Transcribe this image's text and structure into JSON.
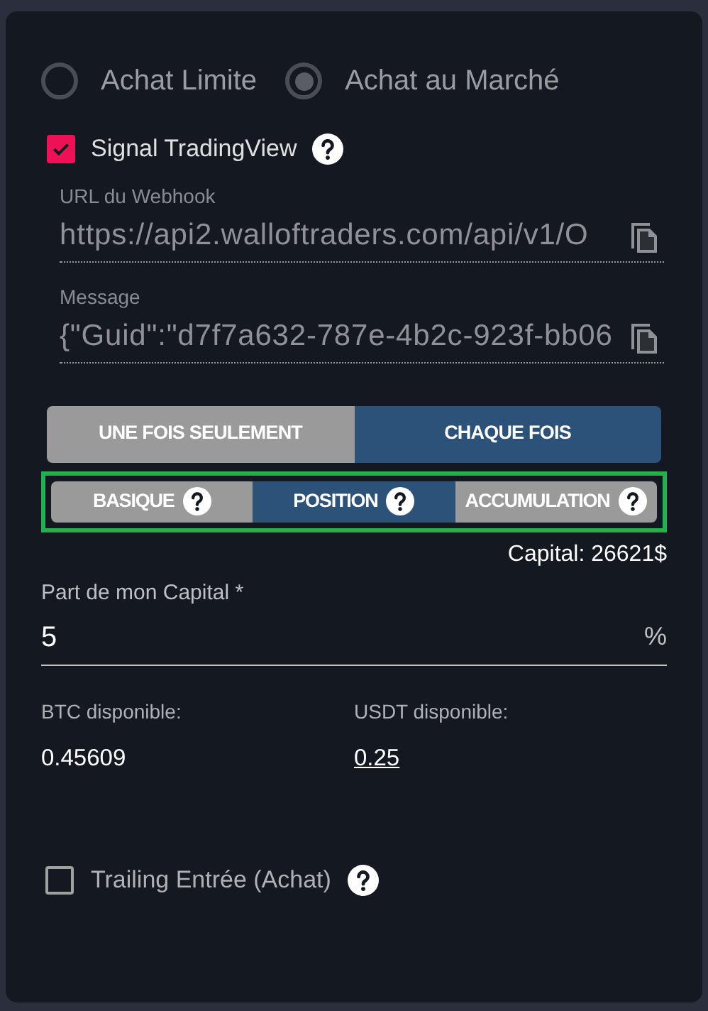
{
  "order_types": [
    {
      "label": "Achat Limite",
      "selected": false
    },
    {
      "label": "Achat au Marché",
      "selected": true
    }
  ],
  "tradingview": {
    "label": "Signal TradingView",
    "checked": true,
    "fields": [
      {
        "label": "URL du Webhook",
        "value": "https://api2.walloftraders.com/api/v1/O"
      },
      {
        "label": "Message",
        "value": "{\"Guid\":\"d7f7a632-787e-4b2c-923f-bb06"
      }
    ]
  },
  "frequency": [
    {
      "label": "UNE FOIS SEULEMENT",
      "selected": false
    },
    {
      "label": "CHAQUE FOIS",
      "selected": true
    }
  ],
  "modes": [
    {
      "label": "BASIQUE",
      "selected": false
    },
    {
      "label": "POSITION",
      "selected": true
    },
    {
      "label": "ACCUMULATION",
      "selected": false
    }
  ],
  "capital": "Capital: 26621$",
  "capital_share": {
    "label": "Part de mon Capital *",
    "value": "5",
    "unit": "%"
  },
  "balances": [
    {
      "label": "BTC disponible:",
      "value": "0.45609",
      "kind": "text"
    },
    {
      "label": "USDT disponible:",
      "value": "0.25",
      "kind": "link"
    }
  ],
  "trailing": {
    "label": "Trailing Entrée (Achat)",
    "checked": false
  }
}
